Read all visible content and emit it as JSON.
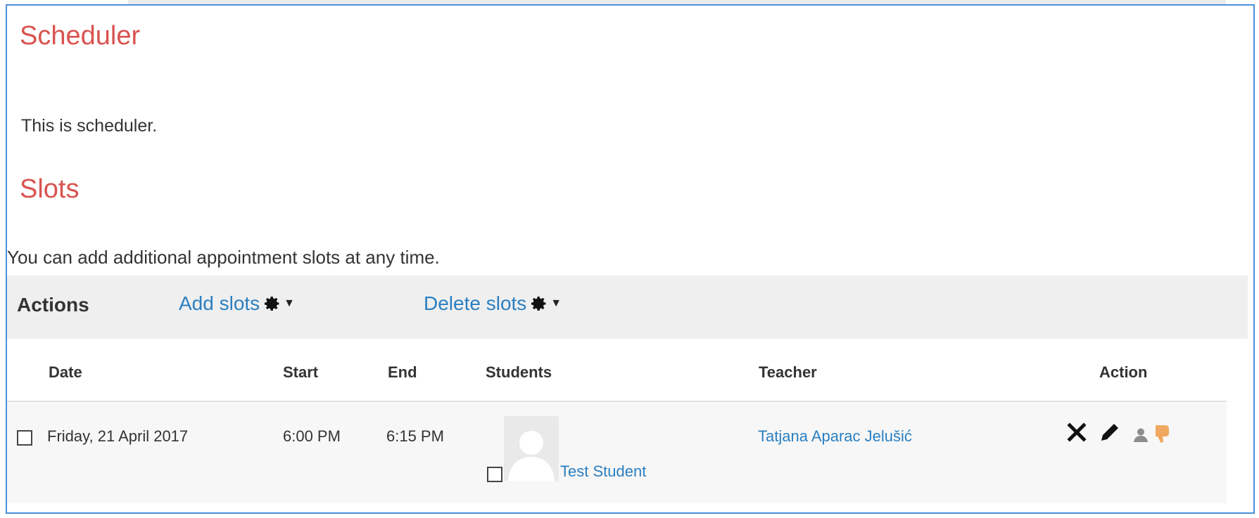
{
  "page": {
    "heading": "Scheduler",
    "intro": "This is scheduler."
  },
  "slots": {
    "heading": "Slots",
    "note": "You can add additional appointment slots at any time."
  },
  "actions_bar": {
    "label": "Actions",
    "add_slots": "Add slots",
    "delete_slots": "Delete slots",
    "menu_icon": "gear-icon",
    "menu_caret": "caret-down-icon"
  },
  "table": {
    "headers": {
      "date": "Date",
      "start": "Start",
      "end": "End",
      "students": "Students",
      "teacher": "Teacher",
      "action": "Action"
    },
    "rows": [
      {
        "date": "Friday, 21 April 2017",
        "start": "6:00 PM",
        "end": "6:15 PM",
        "student": "Test Student",
        "teacher": "Tatjana Aparac Jelušić",
        "selected": false,
        "student_selected": false,
        "action_icons": [
          "delete-icon",
          "edit-icon",
          "user-icon",
          "thumbs-down-icon"
        ]
      }
    ]
  },
  "colors": {
    "heading": "#d9534f",
    "link": "#2a7fc1",
    "frame_border": "#4a90d9",
    "actions_bar_bg": "#efefef",
    "row_bg": "#f7f7f7",
    "thumb_icon": "#f0a860"
  }
}
